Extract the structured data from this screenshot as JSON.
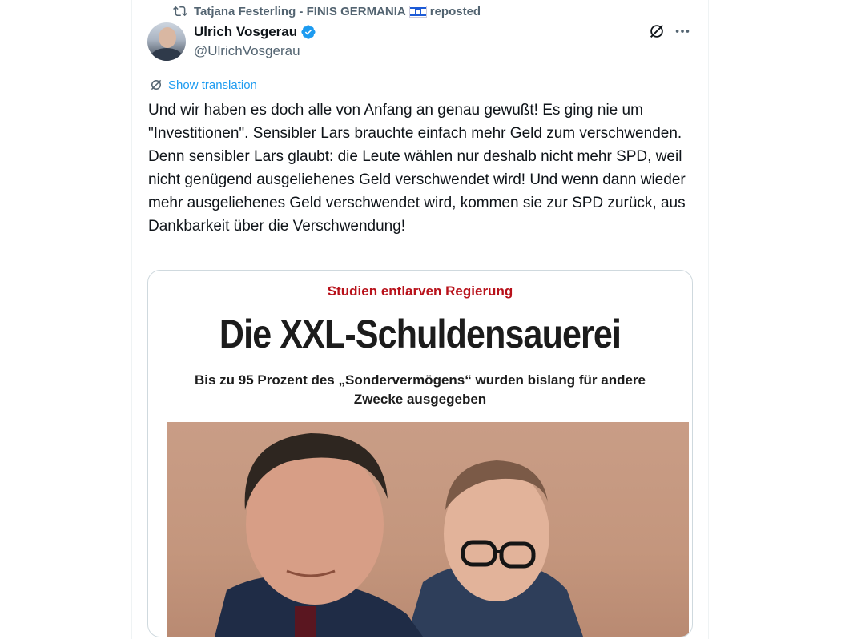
{
  "repost": {
    "name": "Tatjana Festerling - FINIS GERMANIA",
    "suffix": "reposted",
    "flag_icon": "israel-flag-icon"
  },
  "author": {
    "name": "Ulrich Vosgerau",
    "handle": "@UlrichVosgerau",
    "verified": true
  },
  "actions": {
    "grok_icon": "grok-icon",
    "more_icon": "more-icon"
  },
  "translate_label": "Show translation",
  "tweet_text": "Und wir haben es doch alle von Anfang an genau gewußt! Es ging nie um \"Investitionen\". Sensibler Lars brauchte einfach mehr Geld zum verschwenden. Denn sensibler Lars glaubt: die Leute wählen nur deshalb nicht mehr SPD, weil nicht genügend ausgeliehenes Geld verschwendet wird! Und wenn dann wieder mehr ausgeliehenes Geld verschwendet wird, kommen sie zur SPD zurück, aus Dankbarkeit über die Verschwendung!",
  "card": {
    "kicker": "Studien entlarven Regierung",
    "headline": "Die XXL-Schuldensauerei",
    "subheadline": "Bis zu 95 Prozent des „Sondervermögens“ wurden bislang für andere Zwecke ausgegeben"
  },
  "colors": {
    "accent": "#1d9bf0",
    "kicker": "#b8111a",
    "muted": "#536471"
  }
}
